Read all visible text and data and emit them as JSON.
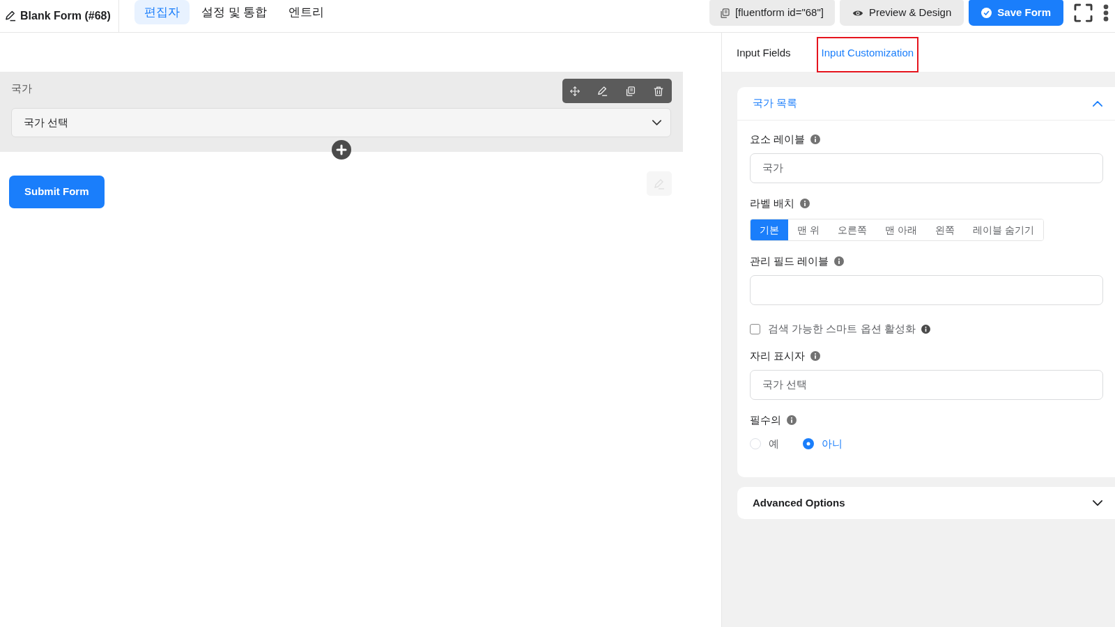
{
  "header": {
    "title": "Blank Form (#68)",
    "tabs": [
      {
        "label": "편집자",
        "selected": true
      },
      {
        "label": "설정 및 통합",
        "selected": false
      },
      {
        "label": "엔트리",
        "selected": false
      }
    ],
    "actions": [
      {
        "kind": "shortcode",
        "label": "[fluentform id=\"68\"]"
      },
      {
        "kind": "preview",
        "label": "Preview & Design"
      },
      {
        "kind": "save",
        "label": "Save Form"
      }
    ]
  },
  "canvas": {
    "field": {
      "label": "국가",
      "placeholder": "국가 선택"
    },
    "submit_button": "Submit Form"
  },
  "panel": {
    "tabs": [
      {
        "label": "Input Fields",
        "selected": false,
        "highlighted": false
      },
      {
        "label": "Input Customization",
        "selected": true,
        "highlighted": true
      }
    ],
    "section": {
      "title": "국가 목록",
      "expanded": true,
      "settings": [
        {
          "kind": "text",
          "label": "요소 레이블",
          "value": "국가"
        },
        {
          "kind": "segmented",
          "label": "라벨 배치",
          "options": [
            {
              "label": "기본",
              "selected": true
            },
            {
              "label": "맨 위",
              "selected": false
            },
            {
              "label": "오른쪽",
              "selected": false
            },
            {
              "label": "맨 아래",
              "selected": false
            },
            {
              "label": "왼쪽",
              "selected": false
            },
            {
              "label": "레이블 숨기기",
              "selected": false
            }
          ]
        },
        {
          "kind": "text",
          "label": "관리 필드 레이블"
        },
        {
          "kind": "checkbox",
          "label": "검색 가능한 스마트 옵션 활성화",
          "checked": false
        },
        {
          "kind": "text",
          "label": "자리 표시자",
          "value": "국가 선택"
        },
        {
          "kind": "radio",
          "label": "필수의",
          "options": [
            {
              "label": "예",
              "selected": false
            },
            {
              "label": "아니",
              "selected": true
            }
          ]
        }
      ]
    },
    "advanced": {
      "title": "Advanced Options",
      "expanded": false
    }
  }
}
